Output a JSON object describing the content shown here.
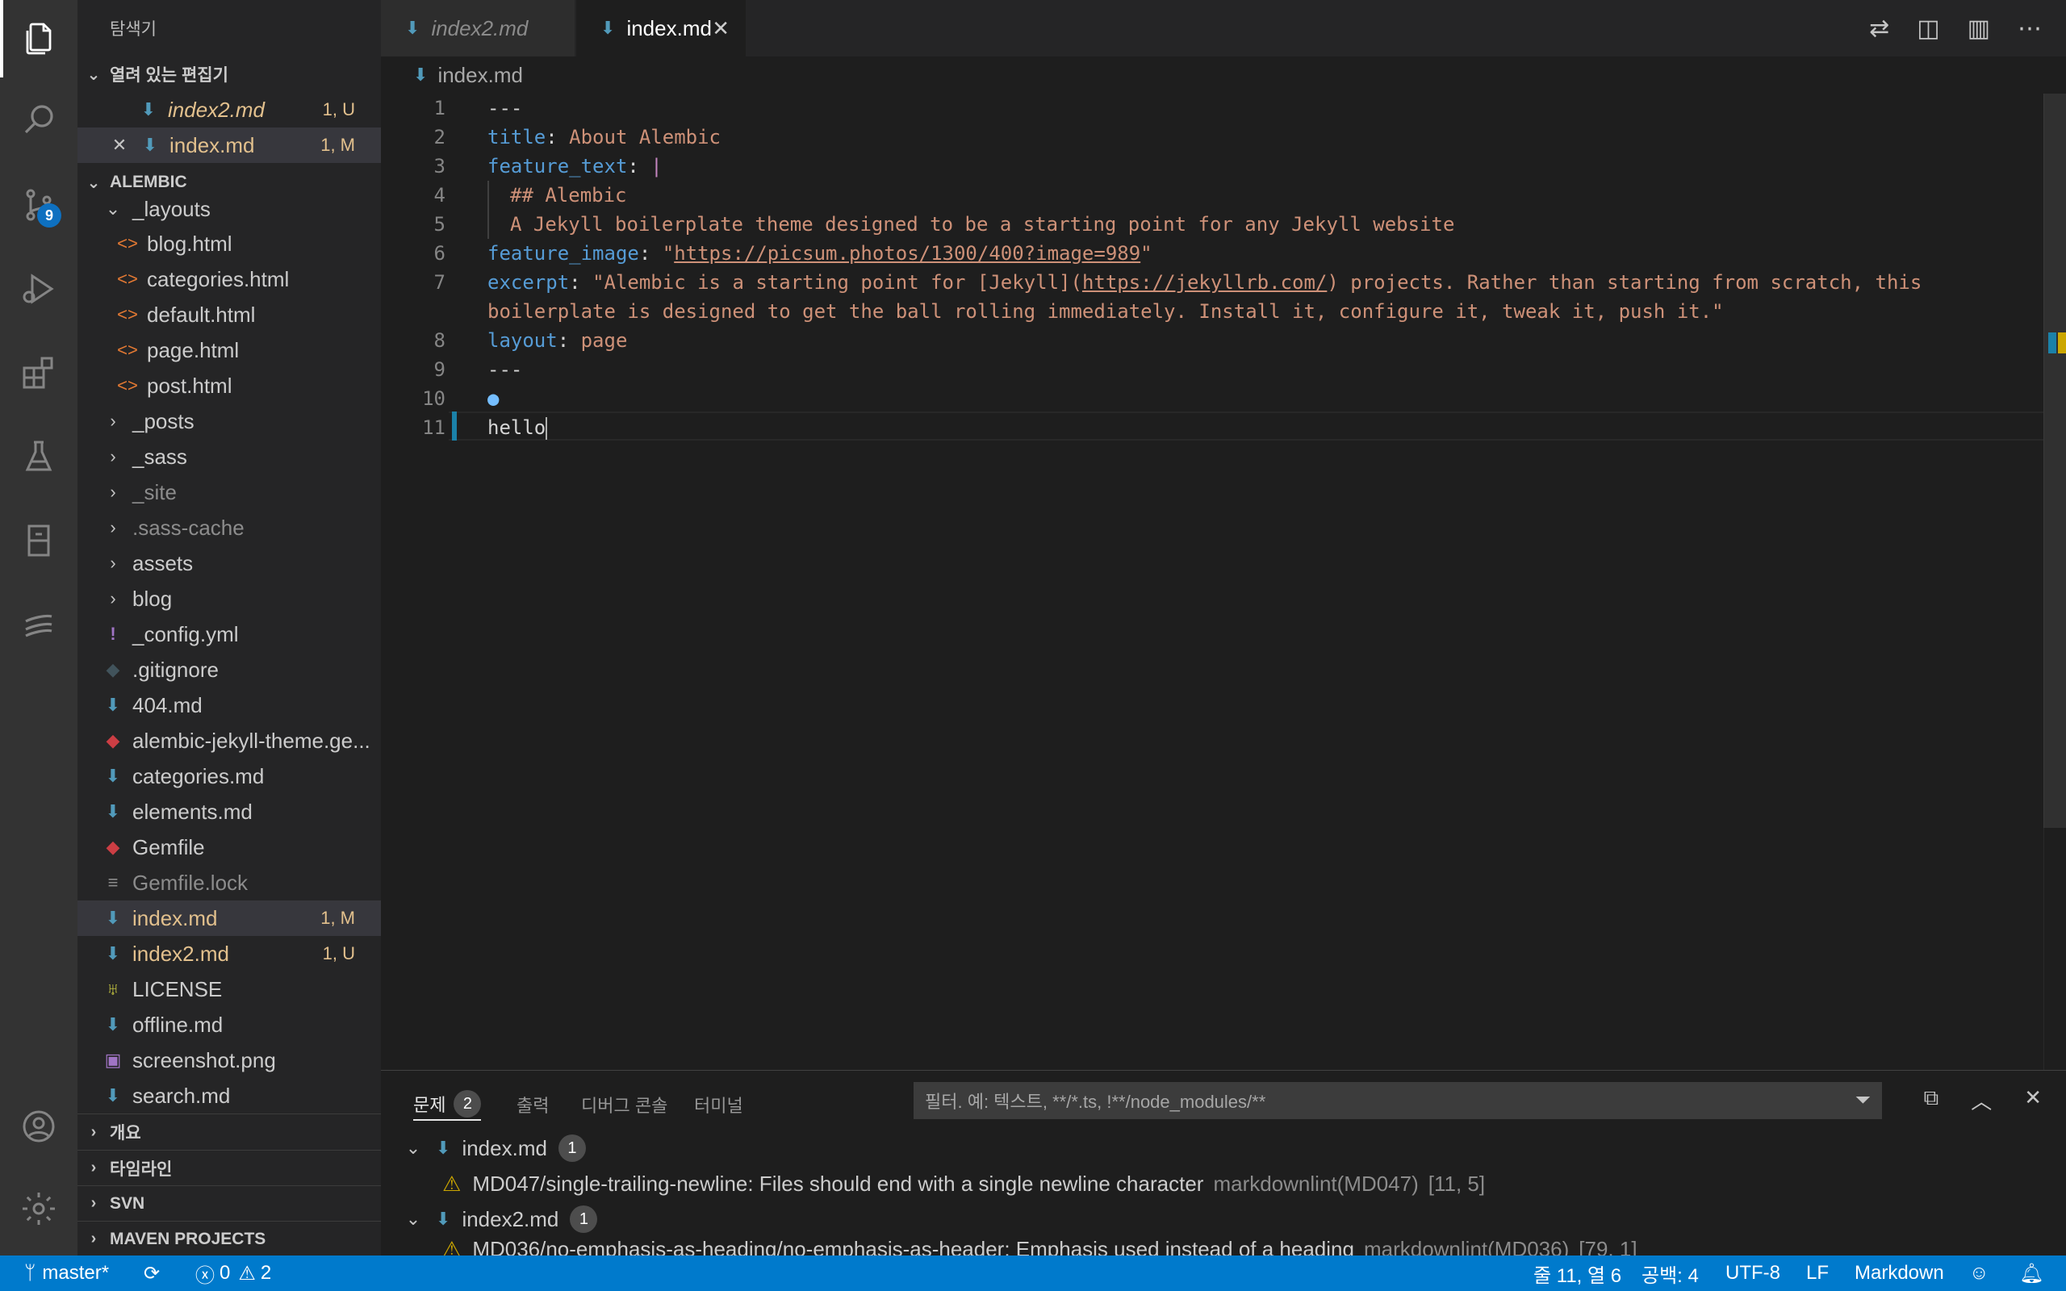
{
  "activity": {
    "scm_badge": "9"
  },
  "sidebar": {
    "title": "탐색기",
    "open_editors_label": "열려 있는 편집기",
    "open_editors": [
      {
        "name": "index2.md",
        "status": "1, U"
      },
      {
        "name": "index.md",
        "status": "1, M"
      }
    ],
    "workspace_label": "ALEMBIC",
    "tree": [
      {
        "name": "_layouts",
        "type": "folder-open"
      },
      {
        "name": "blog.html",
        "type": "html"
      },
      {
        "name": "categories.html",
        "type": "html"
      },
      {
        "name": "default.html",
        "type": "html"
      },
      {
        "name": "page.html",
        "type": "html"
      },
      {
        "name": "post.html",
        "type": "html"
      },
      {
        "name": "_posts",
        "type": "folder"
      },
      {
        "name": "_sass",
        "type": "folder"
      },
      {
        "name": "_site",
        "type": "folder"
      },
      {
        "name": ".sass-cache",
        "type": "folder"
      },
      {
        "name": "assets",
        "type": "folder"
      },
      {
        "name": "blog",
        "type": "folder"
      },
      {
        "name": "_config.yml",
        "type": "yml"
      },
      {
        "name": ".gitignore",
        "type": "git"
      },
      {
        "name": "404.md",
        "type": "md"
      },
      {
        "name": "alembic-jekyll-theme.ge...",
        "type": "gem"
      },
      {
        "name": "categories.md",
        "type": "md"
      },
      {
        "name": "elements.md",
        "type": "md"
      },
      {
        "name": "Gemfile",
        "type": "gem"
      },
      {
        "name": "Gemfile.lock",
        "type": "lock"
      },
      {
        "name": "index.md",
        "type": "md",
        "status": "1, M"
      },
      {
        "name": "index2.md",
        "type": "md",
        "status": "1, U"
      },
      {
        "name": "LICENSE",
        "type": "license"
      },
      {
        "name": "offline.md",
        "type": "md"
      },
      {
        "name": "screenshot.png",
        "type": "png"
      },
      {
        "name": "search.md",
        "type": "md"
      }
    ],
    "bottom_sections": [
      "개요",
      "타임라인",
      "SVN",
      "MAVEN PROJECTS"
    ]
  },
  "tabs": [
    {
      "name": "index2.md",
      "active": false
    },
    {
      "name": "index.md",
      "active": true
    }
  ],
  "breadcrumb": "index.md",
  "editor": {
    "line_numbers": [
      "1",
      "2",
      "3",
      "4",
      "5",
      "6",
      "7",
      "",
      "8",
      "9",
      "10",
      "11"
    ],
    "l1": "---",
    "l2_key": "title",
    "l2_val": "About Alembic",
    "l3_key": "feature_text",
    "l3_val": "|",
    "l4": "## Alembic",
    "l5": "A Jekyll boilerplate theme designed to be a starting point for any Jekyll website",
    "l6_key": "feature_image",
    "l6_q1": "\"",
    "l6_url": "https://picsum.photos/1300/400?image=989",
    "l6_q2": "\"",
    "l7_key": "excerpt",
    "l7_a": "\"Alembic is a starting point for [Jekyll](",
    "l7_url": "https://jekyllrb.com/",
    "l7_b": ") projects. Rather than starting from scratch, this",
    "l7_wrap": "boilerplate is designed to get the ball rolling immediately. Install it, configure it, tweak it, push it.\"",
    "l8_key": "layout",
    "l8_val": "page",
    "l9": "---",
    "l11": "hello"
  },
  "panel": {
    "tabs": [
      "문제",
      "출력",
      "디버그 콘솔",
      "터미널"
    ],
    "problems_count": "2",
    "filter_placeholder": "필터. 예: 텍스트, **/*.ts, !**/node_modules/**",
    "groups": [
      {
        "file": "index.md",
        "count": "1",
        "msg": "MD047/single-trailing-newline: Files should end with a single newline character",
        "source": "markdownlint(MD047)",
        "pos": "[11, 5]"
      },
      {
        "file": "index2.md",
        "count": "1",
        "msg": "MD036/no-emphasis-as-heading/no-emphasis-as-header: Emphasis used instead of a heading",
        "source": "markdownlint(MD036)",
        "pos": "[79, 1]"
      }
    ]
  },
  "status": {
    "branch": "master*",
    "errors": "0",
    "warnings": "2",
    "position": "줄 11, 열 6",
    "spaces": "공백: 4",
    "encoding": "UTF-8",
    "eol": "LF",
    "language": "Markdown"
  },
  "colors": {
    "activity_bg": "#333333",
    "sidebar_bg": "#252526",
    "editor_bg": "#1e1e1e",
    "status_bg": "#007acc",
    "modified": "#e2c08d",
    "badge": "#0e70c0"
  }
}
